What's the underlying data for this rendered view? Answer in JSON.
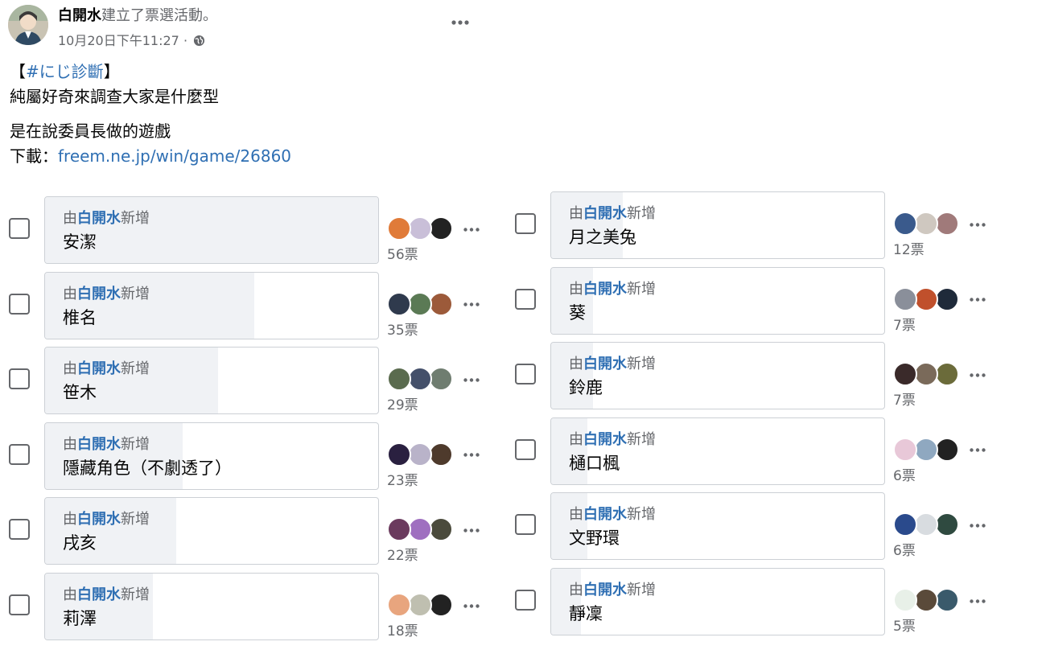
{
  "post": {
    "author": "白開水",
    "action": "建立了票選活動。",
    "timestamp": "10月20日下午11:27",
    "separator": "·",
    "privacy_icon": "globe-icon",
    "more_icon": "more-dots-icon"
  },
  "text": {
    "line1_open": "【",
    "line1_tag": "#にじ診斷",
    "line1_close": "】",
    "line2": "純屬好奇來調查大家是什麼型",
    "line3": "是在說委員長做的遊戲",
    "line4_label": "下載：",
    "line4_link": "freem.ne.jp/win/game/26860"
  },
  "poll": {
    "added_prefix": "由",
    "added_by": "白開水",
    "added_suffix": "新增",
    "options": [
      {
        "label": "安潔",
        "votes": "56票",
        "fraction": 1.0,
        "avatar_colors": [
          "#e07b39",
          "#c9bfd8",
          "#222222"
        ]
      },
      {
        "label": "椎名",
        "votes": "35票",
        "fraction": 0.625,
        "avatar_colors": [
          "#2f3a4d",
          "#5b7a55",
          "#9c5a3a"
        ]
      },
      {
        "label": "笹木",
        "votes": "29票",
        "fraction": 0.518,
        "avatar_colors": [
          "#5a6b4e",
          "#44506a",
          "#6f7d70"
        ]
      },
      {
        "label": "隱藏角色（不劇透了）",
        "votes": "23票",
        "fraction": 0.411,
        "avatar_colors": [
          "#2a2040",
          "#b9b3c9",
          "#4e3a2c"
        ]
      },
      {
        "label": "戌亥",
        "votes": "22票",
        "fraction": 0.393,
        "avatar_colors": [
          "#6b3b5e",
          "#9f6fc0",
          "#4b4b3c"
        ]
      },
      {
        "label": "莉澤",
        "votes": "18票",
        "fraction": 0.321,
        "avatar_colors": [
          "#e8a57e",
          "#bfbfb0",
          "#222222"
        ]
      },
      {
        "label": "月之美兔",
        "votes": "12票",
        "fraction": 0.214,
        "avatar_colors": [
          "#3a5a8c",
          "#cfc8c0",
          "#a07a7a"
        ]
      },
      {
        "label": "葵",
        "votes": "7票",
        "fraction": 0.125,
        "avatar_colors": [
          "#8a8f9a",
          "#c0502c",
          "#1f2a3a"
        ]
      },
      {
        "label": "鈴鹿",
        "votes": "7票",
        "fraction": 0.125,
        "avatar_colors": [
          "#3a2a2a",
          "#7a6a5a",
          "#6b6b3a"
        ]
      },
      {
        "label": "樋口楓",
        "votes": "6票",
        "fraction": 0.107,
        "avatar_colors": [
          "#e8c8d8",
          "#8fa8c0",
          "#222222"
        ]
      },
      {
        "label": "文野環",
        "votes": "6票",
        "fraction": 0.107,
        "avatar_colors": [
          "#2a4a8c",
          "#d8dce0",
          "#2f4a40"
        ]
      },
      {
        "label": "靜凜",
        "votes": "5票",
        "fraction": 0.089,
        "avatar_colors": [
          "#e8f0e8",
          "#5a4a3a",
          "#3a5a6b"
        ]
      }
    ]
  }
}
